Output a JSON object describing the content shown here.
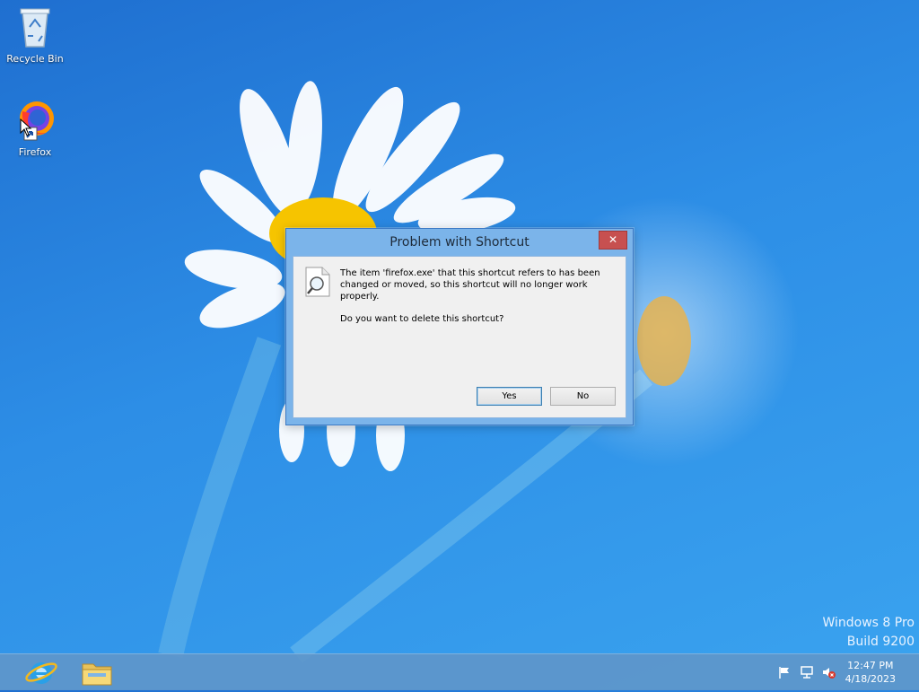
{
  "desktop": {
    "icons": [
      {
        "label": "Recycle Bin",
        "icon": "recycle-bin-icon"
      },
      {
        "label": "Firefox",
        "icon": "firefox-icon"
      }
    ]
  },
  "dialog": {
    "title": "Problem with Shortcut",
    "close_label": "✕",
    "message_line1": "The item 'firefox.exe' that this shortcut refers to has been changed or moved, so this shortcut will no longer work properly.",
    "message_line2": "Do you want to delete this shortcut?",
    "icon": "search-document-icon",
    "yes_label": "Yes",
    "no_label": "No"
  },
  "watermark": {
    "line1": "Windows 8 Pro",
    "line2": "Build 9200"
  },
  "taskbar": {
    "pinned": [
      {
        "icon": "internet-explorer-icon"
      },
      {
        "icon": "file-explorer-icon"
      }
    ],
    "tray": [
      {
        "icon": "action-center-flag-icon"
      },
      {
        "icon": "network-icon"
      },
      {
        "icon": "volume-muted-icon"
      }
    ],
    "clock_time": "12:47 PM",
    "clock_date": "4/18/2023"
  },
  "colors": {
    "desktop_blue": "#2d8ee6",
    "dialog_frame": "#7bb4ea",
    "close_red": "#c75050",
    "taskbar": "#5e96ca"
  }
}
